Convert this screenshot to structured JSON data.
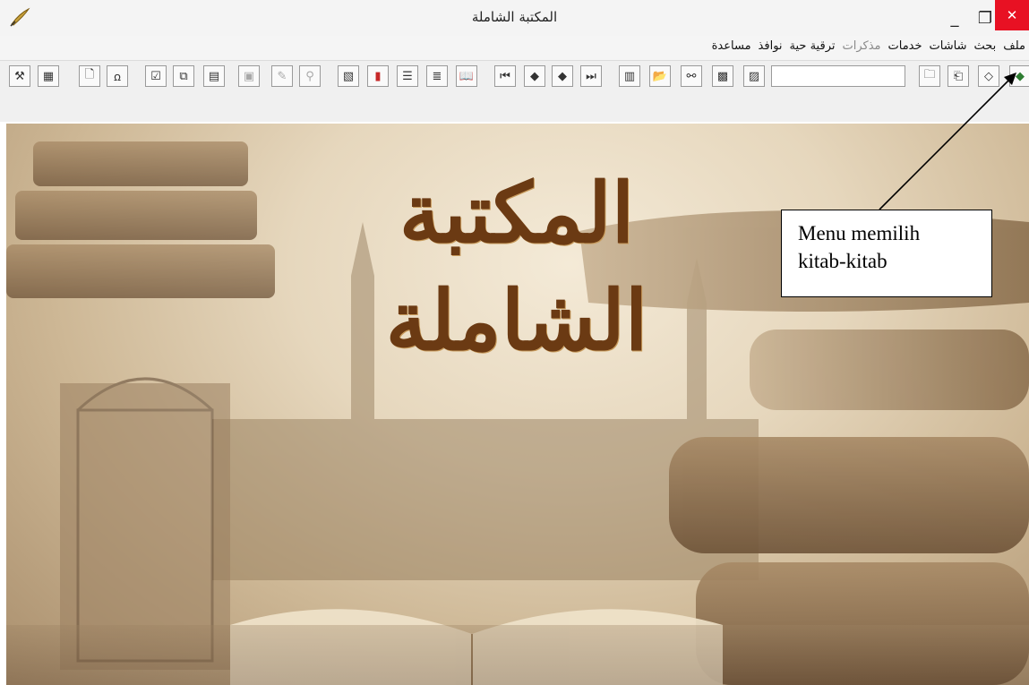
{
  "window": {
    "title": "المكتبة الشاملة",
    "minimize_label": "_",
    "maximize_label": "❐",
    "close_label": "✕"
  },
  "menubar": {
    "items": [
      {
        "label": "ملف",
        "enabled": true
      },
      {
        "label": "بحث",
        "enabled": true
      },
      {
        "label": "شاشات",
        "enabled": true
      },
      {
        "label": "خدمات",
        "enabled": true
      },
      {
        "label": "مذكرات",
        "enabled": false
      },
      {
        "label": "ترقية حية",
        "enabled": true
      },
      {
        "label": "نوافذ",
        "enabled": true
      },
      {
        "label": "مساعدة",
        "enabled": true
      }
    ]
  },
  "toolbar": {
    "search_value": "",
    "buttons": [
      {
        "icon": "tools-icon",
        "glyph": "⚒",
        "enabled": true
      },
      {
        "icon": "index-icon",
        "glyph": "▦",
        "enabled": true
      },
      {
        "icon": "new-page-icon",
        "glyph": "🗋",
        "enabled": true
      },
      {
        "icon": "find-icon",
        "glyph": "ꭥ",
        "enabled": true
      },
      {
        "icon": "checklist-icon",
        "glyph": "☑",
        "enabled": true
      },
      {
        "icon": "copy-icon",
        "glyph": "⧉",
        "enabled": true
      },
      {
        "icon": "document-icon",
        "glyph": "▤",
        "enabled": true
      },
      {
        "icon": "paste-icon",
        "glyph": "▣",
        "enabled": false
      },
      {
        "icon": "pencil-icon",
        "glyph": "✎",
        "enabled": false
      },
      {
        "icon": "brush-icon",
        "glyph": "⚲",
        "enabled": false
      },
      {
        "icon": "properties-icon",
        "glyph": "▧",
        "enabled": true
      },
      {
        "icon": "bookmark-icon",
        "glyph": "▮",
        "enabled": true
      },
      {
        "icon": "outline-icon",
        "glyph": "☰",
        "enabled": true
      },
      {
        "icon": "list-icon",
        "glyph": "≣",
        "enabled": true
      },
      {
        "icon": "open-book-icon",
        "glyph": "📖",
        "enabled": true
      },
      {
        "icon": "first-page-icon",
        "glyph": "⏮",
        "enabled": true
      },
      {
        "icon": "previous-page-icon",
        "glyph": "◆",
        "enabled": true
      },
      {
        "icon": "next-page-icon",
        "glyph": "◆",
        "enabled": true
      },
      {
        "icon": "last-page-icon",
        "glyph": "⏭",
        "enabled": true
      },
      {
        "icon": "windows-icon",
        "glyph": "▥",
        "enabled": true
      },
      {
        "icon": "open-folder-icon",
        "glyph": "📂",
        "enabled": true
      },
      {
        "icon": "binoculars-icon",
        "glyph": "⚯",
        "enabled": true
      },
      {
        "icon": "save-icon",
        "glyph": "▩",
        "enabled": true
      },
      {
        "icon": "print-preview-icon",
        "glyph": "▨",
        "enabled": true
      },
      {
        "icon": "folder-add-icon",
        "glyph": "🗀",
        "enabled": true
      },
      {
        "icon": "page-setup-icon",
        "glyph": "⎗",
        "enabled": true
      },
      {
        "icon": "tag-icon",
        "glyph": "◇",
        "enabled": true
      },
      {
        "icon": "book-select-icon",
        "glyph": "◆",
        "enabled": true
      }
    ]
  },
  "banner": {
    "calligraphy": "المكتبة الشاملة"
  },
  "annotation": {
    "text_line1": "Menu memilih",
    "text_line2": "kitab-kitab"
  },
  "colors": {
    "close_button": "#e81123",
    "calligraphy": "#6b3a13",
    "backdrop_light": "#f4ead7",
    "backdrop_dark": "#a98e6c"
  }
}
